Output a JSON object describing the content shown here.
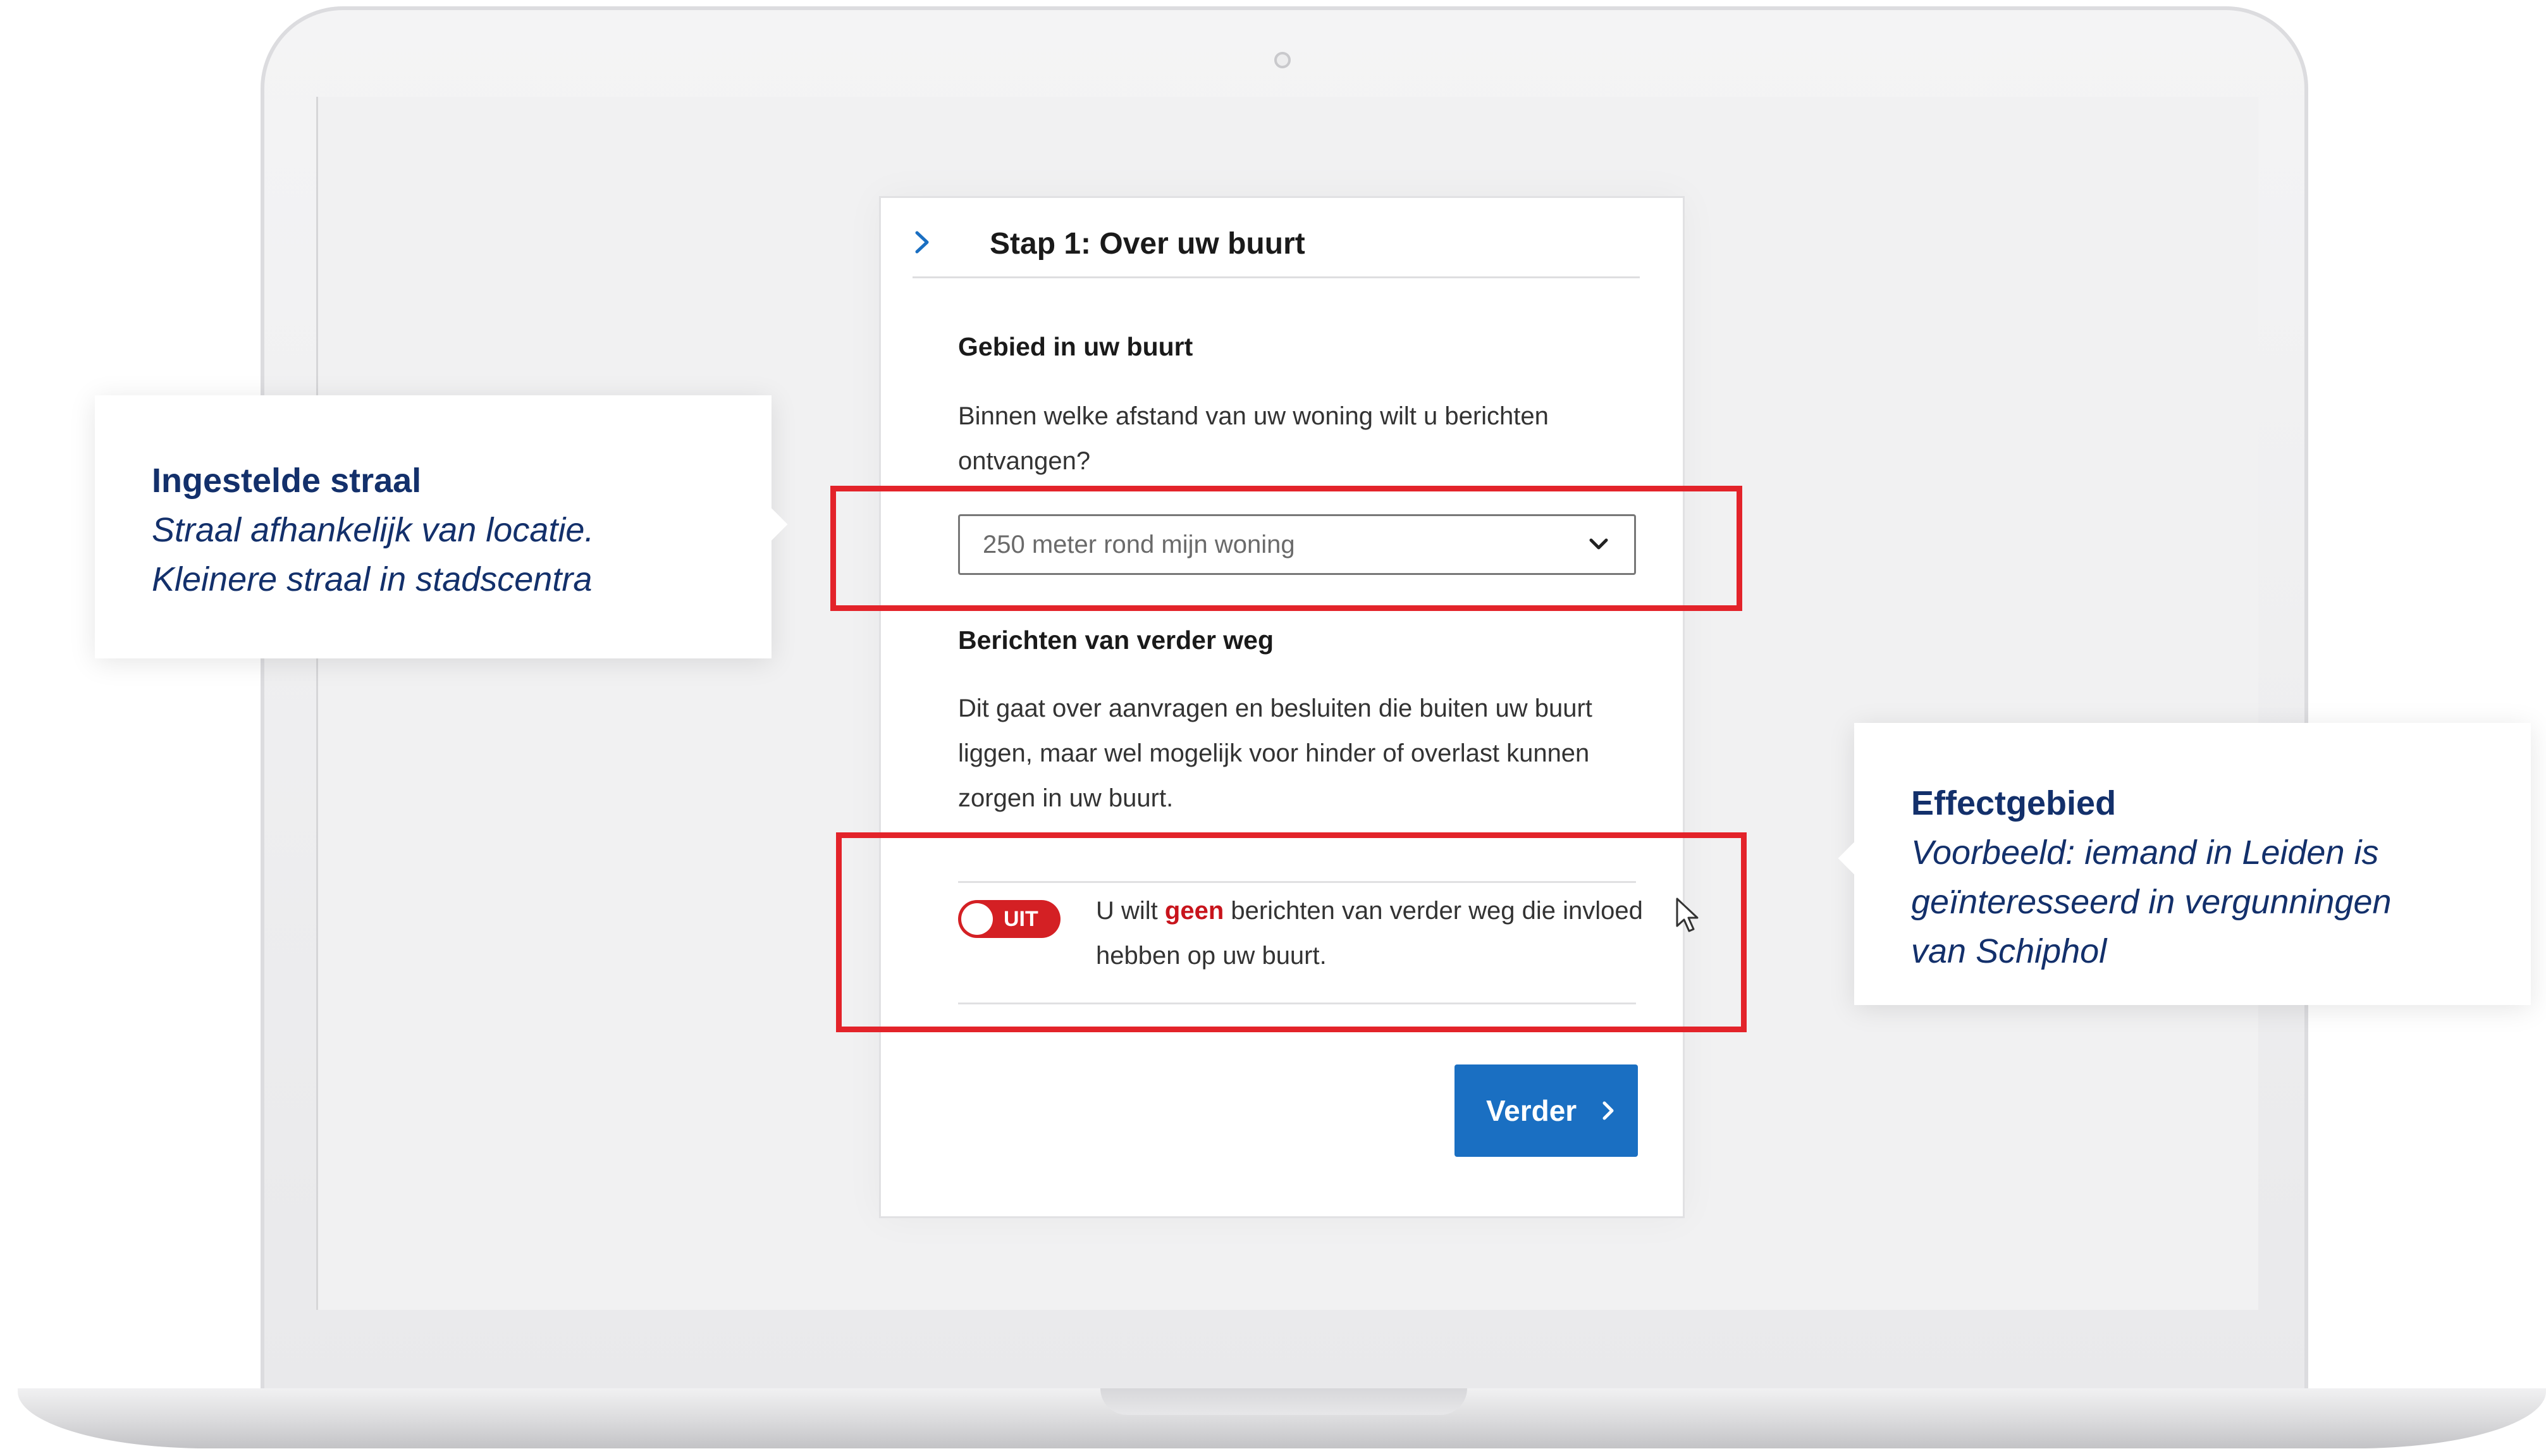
{
  "form": {
    "step_title": "Stap 1: Over uw buurt",
    "section1_title": "Gebied in uw buurt",
    "section1_description": "Binnen welke afstand van uw woning wilt u berichten ontvangen?",
    "distance_select": {
      "value": "250 meter rond mijn woning"
    },
    "section2_title": "Berichten van verder weg",
    "section2_description": "Dit gaat over aanvragen en besluiten die buiten uw buurt liggen, maar wel mogelijk voor hinder of overlast kunnen zorgen in uw buurt.",
    "toggle": {
      "label": "UIT",
      "state": "off",
      "text_before": "U wilt ",
      "text_emphasis": "geen",
      "text_after": " berichten van verder weg die invloed hebben op uw buurt."
    },
    "next_button_label": "Verder"
  },
  "callouts": {
    "left": {
      "title": "Ingestelde straal",
      "text": "Straal afhankelijk van locatie.\nKleinere straal in stadscentra"
    },
    "right": {
      "title": "Effectgebied",
      "text": "Voorbeeld: iemand in Leiden is\ngeïnteresseerd in vergunningen\nvan Schiphol"
    }
  },
  "colors": {
    "accent_blue": "#1a6fc2",
    "highlight_red": "#e3232a",
    "toggle_red": "#d42024",
    "callout_text": "#13306b"
  },
  "icons": {
    "step": "chevron-right-icon",
    "select": "chevron-down-icon",
    "button": "chevron-right-icon",
    "pointer": "mouse-cursor-icon"
  }
}
